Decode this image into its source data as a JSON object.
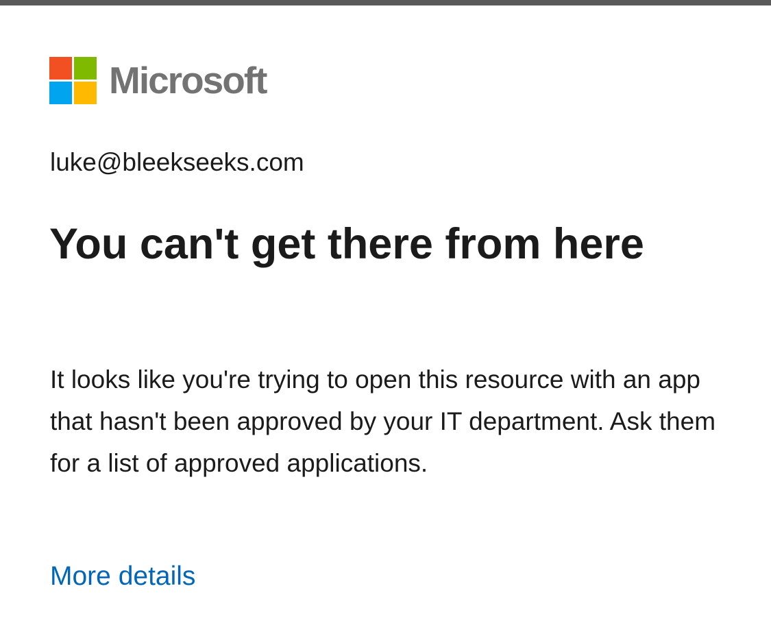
{
  "brand": {
    "name": "Microsoft",
    "logo_colors": [
      "#f25022",
      "#7fba00",
      "#00a4ef",
      "#ffb900"
    ]
  },
  "account": {
    "email": "luke@bleekseeks.com"
  },
  "error": {
    "title": "You can't get there from here",
    "message": "It looks like you're trying to open this resource with an app that hasn't been approved by your IT department. Ask them for a list of approved applications."
  },
  "links": {
    "more_details": "More details"
  },
  "colors": {
    "link": "#0067b8",
    "text": "#1b1b1b",
    "wordmark": "#737373",
    "top_bar": "#5a5a5a"
  }
}
